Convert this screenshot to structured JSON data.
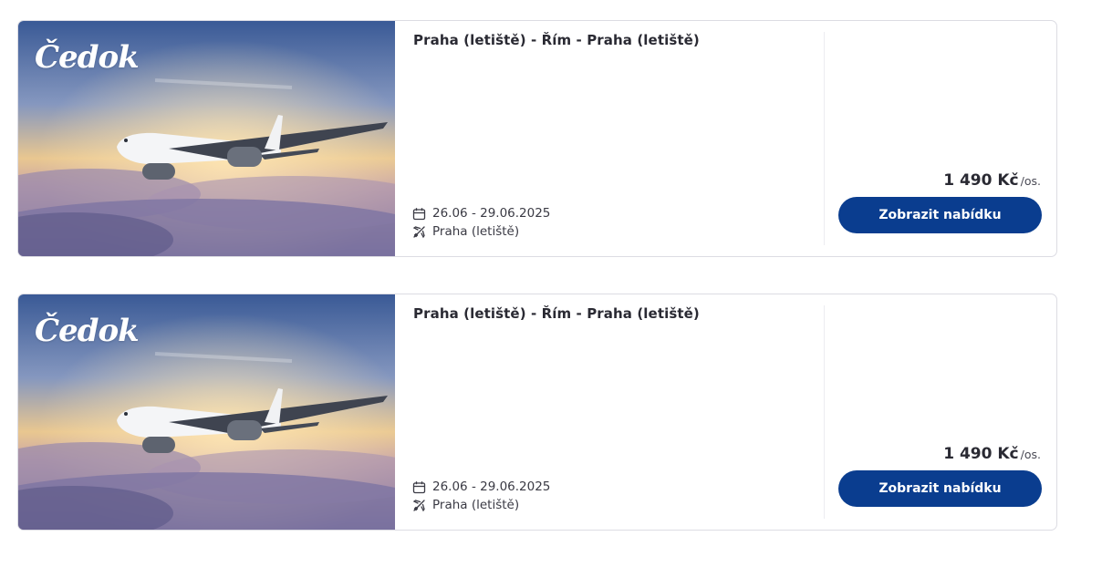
{
  "offers": [
    {
      "logo_text": "Čedok",
      "title": "Praha (letiště) - Řím - Praha (letiště)",
      "dates": "26.06 - 29.06.2025",
      "departure": "Praha (letiště)",
      "price": "1 490 Kč",
      "price_unit": "/os.",
      "cta_label": "Zobrazit nabídku"
    },
    {
      "logo_text": "Čedok",
      "title": "Praha (letiště) - Řím - Praha (letiště)",
      "dates": "26.06 - 29.06.2025",
      "departure": "Praha (letiště)",
      "price": "1 490 Kč",
      "price_unit": "/os.",
      "cta_label": "Zobrazit nabídku"
    }
  ],
  "colors": {
    "button_bg": "#0a3d8f",
    "button_text": "#ffffff",
    "card_border": "#dcdce3"
  },
  "icons": {
    "date": "calendar-icon",
    "departure": "plane-departure-icon"
  }
}
